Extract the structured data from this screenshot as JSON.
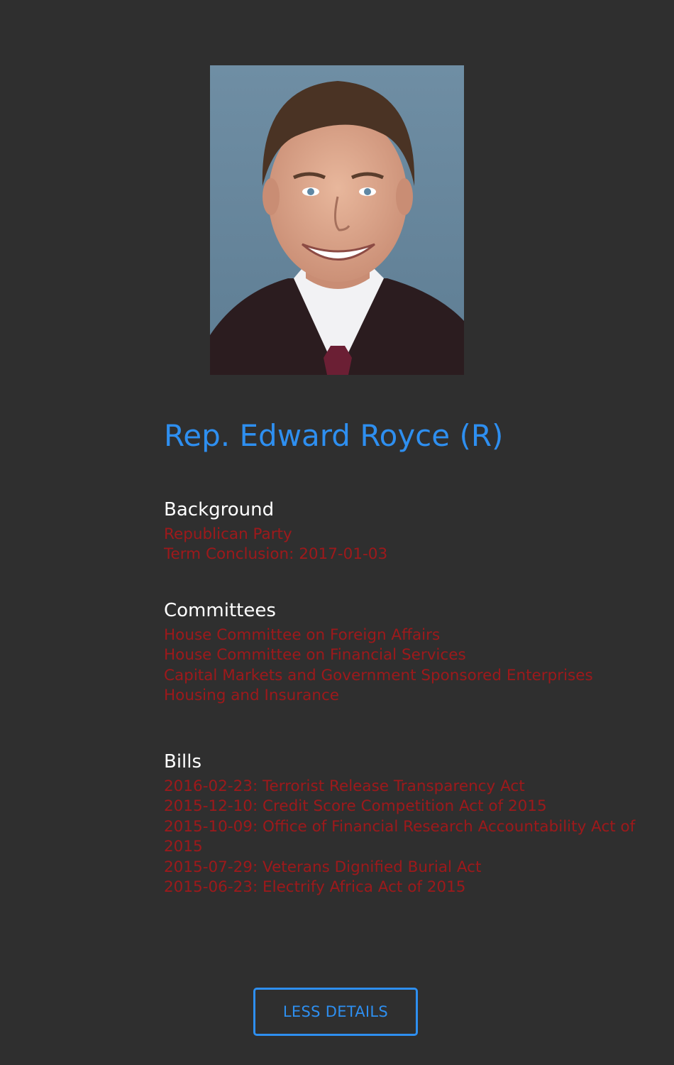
{
  "colors": {
    "background": "#2f2f2f",
    "accent": "#2e8ff0",
    "detail_text": "#a0191b",
    "heading_text": "#ffffff"
  },
  "profile": {
    "name": "Rep. Edward Royce (R)"
  },
  "sections": {
    "background": {
      "heading": "Background",
      "items": [
        "Republican Party",
        "Term Conclusion: 2017-01-03"
      ]
    },
    "committees": {
      "heading": "Committees",
      "items": [
        "House Committee on Foreign Affairs",
        "House Committee on Financial Services",
        "Capital Markets and Government Sponsored Enterprises",
        "Housing and Insurance"
      ]
    },
    "bills": {
      "heading": "Bills",
      "items": [
        "2016-02-23: Terrorist Release Transparency Act",
        "2015-12-10: Credit Score Competition Act of 2015",
        "2015-10-09: Office of Financial Research Accountability Act of 2015",
        "2015-07-29: Veterans Dignified Burial Act",
        "2015-06-23: Electrify Africa Act of 2015"
      ]
    }
  },
  "actions": {
    "toggle_details_label": "LESS DETAILS"
  }
}
